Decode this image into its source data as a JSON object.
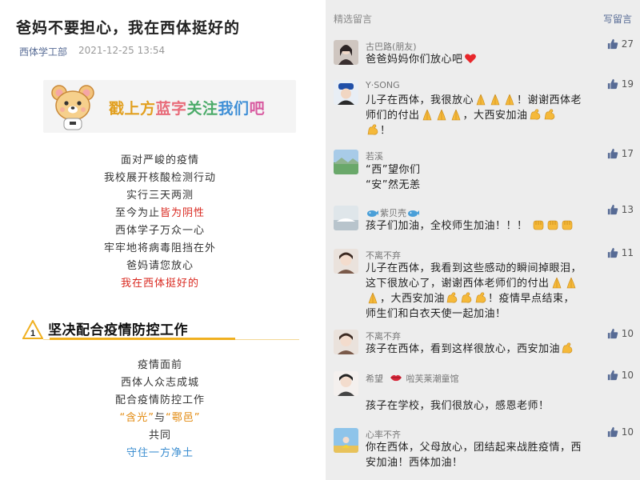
{
  "article": {
    "title": "爸妈不要担心，我在西体挺好的",
    "author": "西体学工部",
    "date": "2021-12-25 13:54",
    "banner": {
      "part1": "戳上方",
      "part2": "蓝字",
      "part3": "关注",
      "part4": "我们",
      "part5": "吧"
    },
    "poem1": [
      {
        "text": "面对严峻的疫情"
      },
      {
        "text": "我校展开核酸检测行动"
      },
      {
        "text": "实行三天两测"
      },
      {
        "prefix": "至今为止",
        "highlight": "皆为阴性"
      },
      {
        "text": "西体学子万众一心"
      },
      {
        "text": "牢牢地将病毒阻挡在外"
      },
      {
        "text": "爸妈请您放心"
      },
      {
        "highlight": "我在西体挺好的"
      }
    ],
    "section": {
      "number": "1",
      "title": "坚决配合疫情防控工作"
    },
    "poem2": [
      {
        "text": "疫情面前"
      },
      {
        "text": "西体人众志成城"
      },
      {
        "text": "配合疫情防控工作"
      },
      {
        "part1": "“含光”",
        "part2": "与",
        "part3": "“鄠邑”"
      },
      {
        "text": "共同"
      },
      {
        "text": "守住一方净土"
      }
    ]
  },
  "comments_panel": {
    "header_label": "精选留言",
    "write_label": "写留言",
    "items": [
      {
        "nick": "古巴路(朋友)",
        "likes": "27",
        "text1": "爸爸妈妈你们放心吧"
      },
      {
        "nick": "Y·SONG",
        "likes": "19",
        "text1": "儿子在西体，我很放心",
        "text2": "！谢谢西体老",
        "text3": "师们的付出",
        "text4": "，大西安加油",
        "text5": "！"
      },
      {
        "nick": "若溪",
        "likes": "17",
        "text1": "“西”望你们",
        "text2": "“安”然无恙"
      },
      {
        "nick": "紫贝壳",
        "likes": "13",
        "text1": "孩子们加油，全校师生加油！！！"
      },
      {
        "nick": "不离不弃",
        "likes": "11",
        "text1": "儿子在西体，我看到这些感动的瞬间掉眼泪，",
        "text2": "这下很放心了，谢谢西体老师们的付出",
        "text3": "，大西安加油",
        "text4": "！疫情早点结束，",
        "text5": "师生们和白衣天使一起加油！"
      },
      {
        "nick": "不离不弃",
        "likes": "10",
        "text1": "孩子在西体，看到这样很放心，西安加油"
      },
      {
        "nick": "希望",
        "nick2": "啦芙莱潮童馆",
        "likes": "10",
        "text1": "孩子在学校，我们很放心，感恩老师！"
      },
      {
        "nick": "心率不齐",
        "likes": "10",
        "text1": "你在西体，父母放心，团结起来战胜疫情，西",
        "text2": "安加油！西体加油！"
      }
    ]
  },
  "colors": {
    "link_blue": "#576b95",
    "highlight_red": "#d9281f",
    "highlight_orange": "#e28a10",
    "highlight_blue": "#3a8dd0",
    "section_accent": "#f0b020",
    "comments_bg": "#ededed"
  },
  "icons": [
    "bear-mascot-icon",
    "number-badge-icon",
    "thumbs-up-icon",
    "heart-emoji-icon",
    "pray-hands-emoji-icon",
    "flex-arm-emoji-icon",
    "fist-emoji-icon",
    "whale-emoji-icon",
    "lips-emoji-icon"
  ]
}
